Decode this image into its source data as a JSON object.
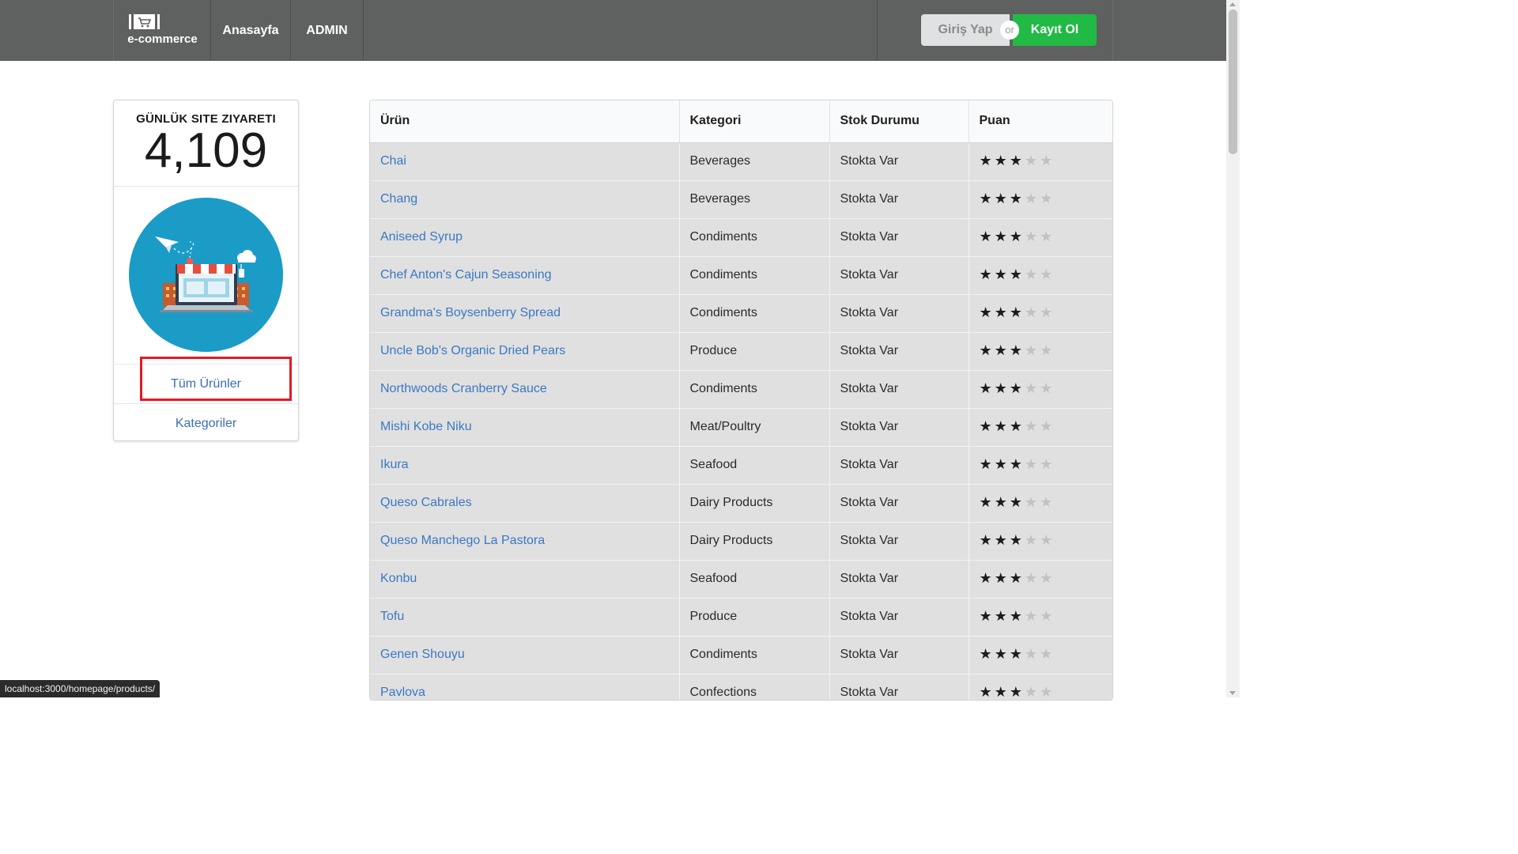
{
  "navbar": {
    "brand": "e-commerce",
    "brand_icon": "shopping-cart-icon",
    "items": [
      {
        "label": "Anasayfa"
      },
      {
        "label": "ADMIN"
      }
    ],
    "auth": {
      "login_label": "Giriş Yap",
      "or_label": "or",
      "register_label": "Kayıt Ol"
    }
  },
  "sidebar": {
    "stat_label": "GÜNLÜK SITE ZIYARETI",
    "stat_value": "4,109",
    "illustration_icon": "online-store-laptop-icon",
    "menu": [
      {
        "label": "Tüm Ürünler"
      },
      {
        "label": "Kategoriler"
      }
    ]
  },
  "table": {
    "headers": [
      "Ürün",
      "Kategori",
      "Stok Durumu",
      "Puan"
    ],
    "rows": [
      {
        "product": "Chai",
        "category": "Beverages",
        "stock": "Stokta Var",
        "rating": 3
      },
      {
        "product": "Chang",
        "category": "Beverages",
        "stock": "Stokta Var",
        "rating": 3
      },
      {
        "product": "Aniseed Syrup",
        "category": "Condiments",
        "stock": "Stokta Var",
        "rating": 3
      },
      {
        "product": "Chef Anton's Cajun Seasoning",
        "category": "Condiments",
        "stock": "Stokta Var",
        "rating": 3
      },
      {
        "product": "Grandma's Boysenberry Spread",
        "category": "Condiments",
        "stock": "Stokta Var",
        "rating": 3
      },
      {
        "product": "Uncle Bob's Organic Dried Pears",
        "category": "Produce",
        "stock": "Stokta Var",
        "rating": 3
      },
      {
        "product": "Northwoods Cranberry Sauce",
        "category": "Condiments",
        "stock": "Stokta Var",
        "rating": 3
      },
      {
        "product": "Mishi Kobe Niku",
        "category": "Meat/Poultry",
        "stock": "Stokta Var",
        "rating": 3
      },
      {
        "product": "Ikura",
        "category": "Seafood",
        "stock": "Stokta Var",
        "rating": 3
      },
      {
        "product": "Queso Cabrales",
        "category": "Dairy Products",
        "stock": "Stokta Var",
        "rating": 3
      },
      {
        "product": "Queso Manchego La Pastora",
        "category": "Dairy Products",
        "stock": "Stokta Var",
        "rating": 3
      },
      {
        "product": "Konbu",
        "category": "Seafood",
        "stock": "Stokta Var",
        "rating": 3
      },
      {
        "product": "Tofu",
        "category": "Produce",
        "stock": "Stokta Var",
        "rating": 3
      },
      {
        "product": "Genen Shouyu",
        "category": "Condiments",
        "stock": "Stokta Var",
        "rating": 3
      },
      {
        "product": "Pavlova",
        "category": "Confections",
        "stock": "Stokta Var",
        "rating": 3
      }
    ],
    "rating_max": 5
  },
  "statusbar": {
    "url": "localhost:3000/homepage/products/"
  },
  "colors": {
    "navbar_bg": "#5f6060",
    "register_green": "#21ba45",
    "link_blue": "#3a78c3",
    "highlight_red": "#e01b24",
    "illustration_teal": "#1a9cc7"
  }
}
